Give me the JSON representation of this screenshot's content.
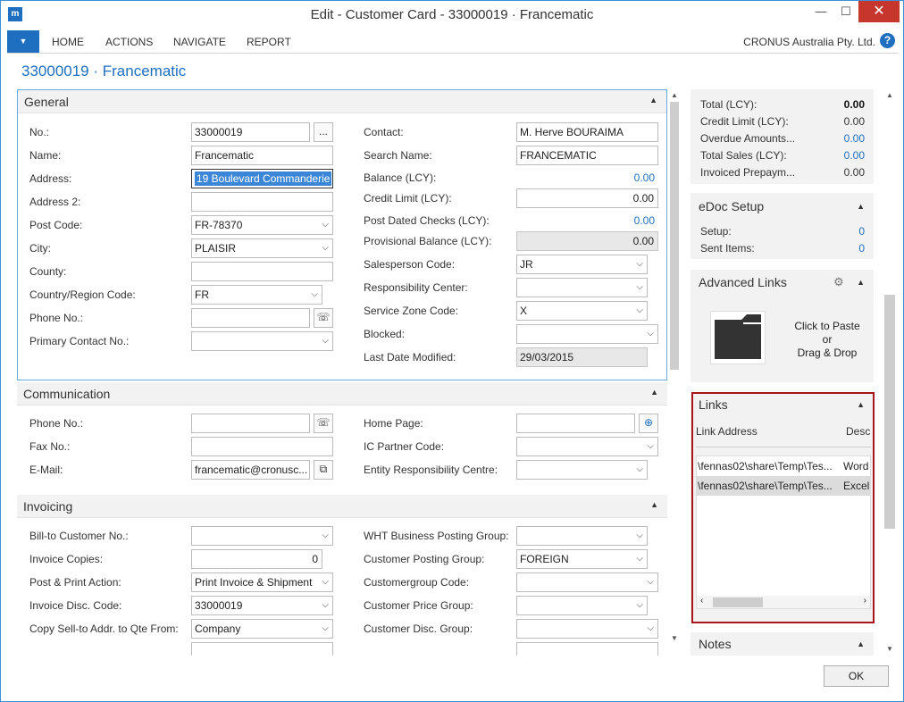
{
  "window": {
    "title": "Edit - Customer Card - 33000019 · Francematic",
    "app_icon": "dynamics-logo-icon",
    "minimize": "—",
    "maximize": "☐",
    "close": "✕"
  },
  "ribbon": {
    "app_menu": "▼",
    "tabs": [
      "HOME",
      "ACTIONS",
      "NAVIGATE",
      "REPORT"
    ],
    "company": "CRONUS Australia Pty. Ltd.",
    "help": "?"
  },
  "page_title": "33000019 · Francematic",
  "general": {
    "title": "General",
    "left": {
      "no_label": "No.:",
      "no_value": "33000019",
      "no_button": "...",
      "name_label": "Name:",
      "name_value": "Francematic",
      "address_label": "Address:",
      "address_value": "19 Boulevard Commanderie",
      "address2_label": "Address 2:",
      "address2_value": "",
      "post_code_label": "Post Code:",
      "post_code_value": "FR-78370",
      "city_label": "City:",
      "city_value": "PLAISIR",
      "county_label": "County:",
      "county_value": "",
      "country_label": "Country/Region Code:",
      "country_value": "FR",
      "phone_label": "Phone No.:",
      "phone_value": "",
      "primary_contact_label": "Primary Contact No.:",
      "primary_contact_value": ""
    },
    "right": {
      "contact_label": "Contact:",
      "contact_value": "M. Herve BOURAIMA",
      "search_name_label": "Search Name:",
      "search_name_value": "FRANCEMATIC",
      "balance_label": "Balance (LCY):",
      "balance_value": "0.00",
      "credit_limit_label": "Credit Limit (LCY):",
      "credit_limit_value": "0.00",
      "post_dated_label": "Post Dated Checks (LCY):",
      "post_dated_value": "0.00",
      "provisional_label": "Provisional Balance (LCY):",
      "provisional_value": "0.00",
      "salesperson_label": "Salesperson Code:",
      "salesperson_value": "JR",
      "responsibility_label": "Responsibility Center:",
      "responsibility_value": "",
      "service_zone_label": "Service Zone Code:",
      "service_zone_value": "X",
      "blocked_label": "Blocked:",
      "blocked_value": "",
      "last_modified_label": "Last Date Modified:",
      "last_modified_value": "29/03/2015"
    }
  },
  "communication": {
    "title": "Communication",
    "phone_label": "Phone No.:",
    "phone_value": "",
    "fax_label": "Fax No.:",
    "fax_value": "",
    "email_label": "E-Mail:",
    "email_value": "francematic@cronusc...",
    "home_page_label": "Home Page:",
    "home_page_value": "",
    "ic_partner_label": "IC Partner Code:",
    "ic_partner_value": "",
    "entity_resp_label": "Entity Responsibility Centre:",
    "entity_resp_value": ""
  },
  "invoicing": {
    "title": "Invoicing",
    "bill_to_label": "Bill-to Customer No.:",
    "bill_to_value": "",
    "invoice_copies_label": "Invoice Copies:",
    "invoice_copies_value": "0",
    "post_print_label": "Post & Print Action:",
    "post_print_value": "Print Invoice & Shipment",
    "invoice_disc_label": "Invoice Disc. Code:",
    "invoice_disc_value": "33000019",
    "copy_sell_label": "Copy Sell-to Addr. to Qte From:",
    "copy_sell_value": "Company",
    "wht_label": "WHT Business Posting Group:",
    "wht_value": "",
    "cust_posting_label": "Customer Posting Group:",
    "cust_posting_value": "FOREIGN",
    "custgroup_label": "Customergroup Code:",
    "custgroup_value": "",
    "cust_price_label": "Customer Price Group:",
    "cust_price_value": "",
    "cust_disc_label": "Customer Disc. Group:",
    "cust_disc_value": ""
  },
  "statistics": {
    "rows": [
      {
        "label": "Total (LCY):",
        "value": "0.00"
      },
      {
        "label": "Credit Limit (LCY):",
        "value": "0.00"
      },
      {
        "label": "Overdue Amounts...",
        "value": "0.00"
      },
      {
        "label": "Total Sales (LCY):",
        "value": "0.00"
      },
      {
        "label": "Invoiced Prepaym...",
        "value": "0.00"
      }
    ]
  },
  "edoc": {
    "title": "eDoc Setup",
    "setup_label": "Setup:",
    "setup_value": "0",
    "sent_label": "Sent Items:",
    "sent_value": "0"
  },
  "advanced_links": {
    "title": "Advanced Links",
    "drop_line1": "Click to Paste",
    "drop_line2": "or",
    "drop_line3": "Drag & Drop"
  },
  "links": {
    "title": "Links",
    "col_address": "Link Address",
    "col_desc": "Desc",
    "rows": [
      {
        "address": "\\fennas02\\share\\Temp\\Tes...",
        "desc": "Word"
      },
      {
        "address": "\\fennas02\\share\\Temp\\Tes...",
        "desc": "Excel"
      }
    ]
  },
  "notes": {
    "title": "Notes"
  },
  "footer": {
    "ok": "OK"
  },
  "colors": {
    "accent": "#1e6fc0",
    "close": "#c7362c",
    "highlight": "#a8151a"
  }
}
